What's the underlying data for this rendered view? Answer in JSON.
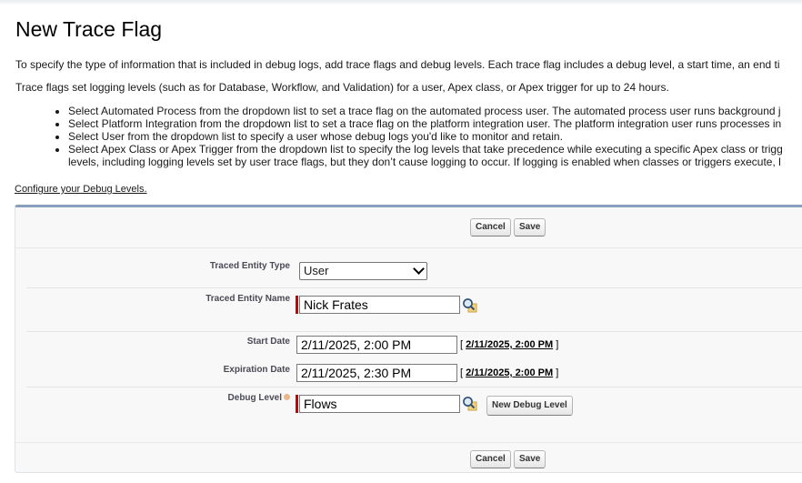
{
  "page": {
    "title": "New Trace Flag",
    "intro1": "To specify the type of information that is included in debug logs, add trace flags and debug levels. Each trace flag includes a debug level, a start time, an end ti",
    "intro2": "Trace flags set logging levels (such as for Database, Workflow, and Validation) for a user, Apex class, or Apex trigger for up to 24 hours.",
    "bullets": [
      "Select Automated Process from the dropdown list to set a trace flag on the automated process user. The automated process user runs background j",
      "Select Platform Integration from the dropdown list to set a trace flag on the platform integration user. The platform integration user runs processes in",
      "Select User from the dropdown list to specify a user whose debug logs you'd like to monitor and retain.",
      "Select Apex Class or Apex Trigger from the dropdown list to specify the log levels that take precedence while executing a specific Apex class or trigg",
      "levels, including logging levels set by user trace flags, but they don’t cause logging to occur. If logging is enabled when classes or triggers execute, l"
    ],
    "config_link": "Configure your Debug Levels."
  },
  "buttons": {
    "cancel": "Cancel",
    "save": "Save",
    "new_debug_level": "New Debug Level"
  },
  "form": {
    "traced_entity_type": {
      "label": "Traced Entity Type",
      "value": "User"
    },
    "traced_entity_name": {
      "label": "Traced Entity Name",
      "value": "Nick Frates"
    },
    "start_date": {
      "label": "Start Date",
      "value": "2/11/2025, 2:00 PM",
      "link": "2/11/2025, 2:00 PM"
    },
    "expiration_date": {
      "label": "Expiration Date",
      "value": "2/11/2025, 2:30 PM",
      "link": "2/11/2025, 2:00 PM"
    },
    "debug_level": {
      "label": "Debug Level",
      "value": "Flows"
    }
  },
  "brackets": {
    "open": "[",
    "close": "]"
  },
  "colors": {
    "required": "#cc0000",
    "panel_top": "#8a9ebe"
  }
}
